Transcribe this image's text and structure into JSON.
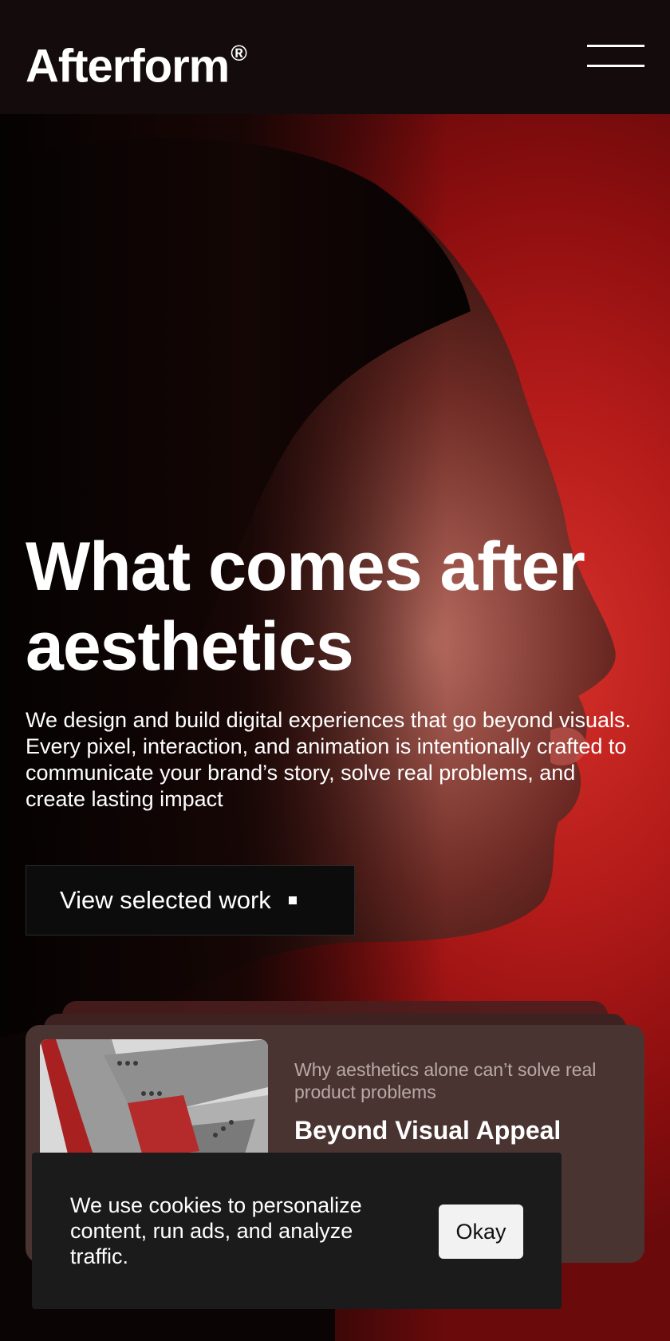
{
  "header": {
    "logo": "Afterform",
    "logo_mark": "®",
    "menu_icon": "hamburger-menu-icon"
  },
  "hero": {
    "headline": "What comes after aesthetics",
    "subtext": "We design and build digital experiences that go beyond visuals. Every pixel, interaction, and animation is intentionally crafted to communicate your brand’s story, solve real problems, and create lasting impact",
    "cta_label": "View selected work"
  },
  "featured_card": {
    "kicker": "Why aesthetics alone can’t solve real product problems",
    "title": "Beyond Visual Appeal"
  },
  "cookie_banner": {
    "message": "We use cookies to personalize content, run ads, and analyze traffic.",
    "button_label": "Okay"
  },
  "colors": {
    "accent_red": "#c4221f",
    "header_bg": "#140c0c",
    "card_bg": "#4a3431",
    "banner_bg": "#1b1b1c"
  }
}
